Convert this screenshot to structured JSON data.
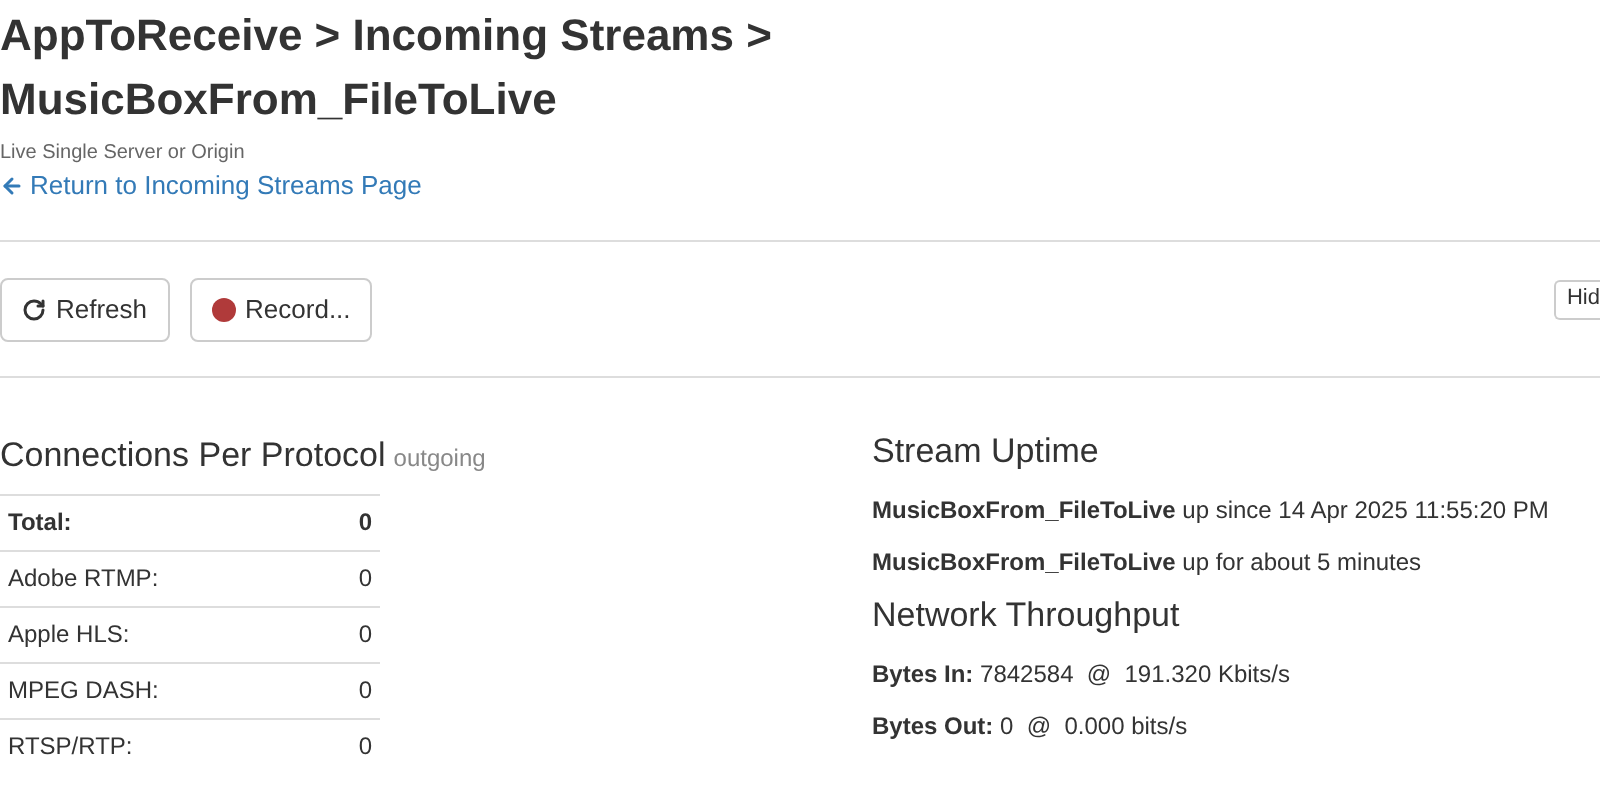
{
  "breadcrumb": {
    "title": "AppToReceive > Incoming Streams > MusicBoxFrom_FileToLive",
    "subtitle": "Live Single Server or Origin",
    "back_link": "Return to Incoming Streams Page"
  },
  "toolbar": {
    "buttons": [
      {
        "kind": "refresh",
        "label": "Refresh"
      },
      {
        "kind": "record",
        "label": "Record..."
      }
    ],
    "right_button": "Hid"
  },
  "connections": {
    "title": "Connections Per Protocol",
    "note": "outgoing",
    "rows": [
      {
        "label": "Total:",
        "value": "0",
        "bold": true
      },
      {
        "label": "Adobe RTMP:",
        "value": "0",
        "bold": false
      },
      {
        "label": "Apple HLS:",
        "value": "0",
        "bold": false
      },
      {
        "label": "MPEG DASH:",
        "value": "0",
        "bold": false
      },
      {
        "label": "RTSP/RTP:",
        "value": "0",
        "bold": false
      }
    ]
  },
  "uptime": {
    "title": "Stream Uptime",
    "lines": [
      "**MusicBoxFrom_FileToLive** up since 14 Apr 2025 11:55:20 PM",
      "**MusicBoxFrom_FileToLive** up for about 5 minutes"
    ]
  },
  "throughput": {
    "title": "Network Throughput",
    "lines": [
      "**Bytes In:** 7842584  @  191.320 Kbits/s",
      "**Bytes Out:** 0  @  0.000 bits/s"
    ]
  }
}
